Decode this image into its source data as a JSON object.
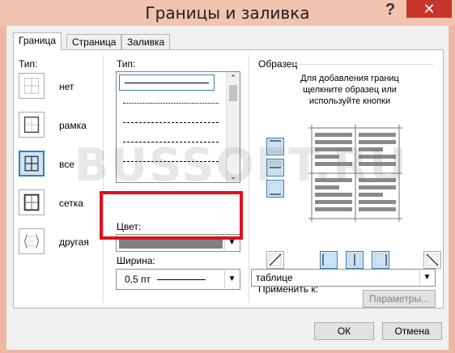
{
  "window": {
    "title": "Границы и заливка",
    "help": "?",
    "close": "✕"
  },
  "tabs": [
    {
      "label": "Граница",
      "active": true
    },
    {
      "label": "Страница",
      "active": false
    },
    {
      "label": "Заливка",
      "active": false
    }
  ],
  "presets": {
    "heading": "Тип:",
    "items": [
      {
        "label": "нет",
        "selected": false
      },
      {
        "label": "рамка",
        "selected": false
      },
      {
        "label": "все",
        "selected": true
      },
      {
        "label": "сетка",
        "selected": false
      },
      {
        "label": "другая",
        "selected": false
      }
    ]
  },
  "style": {
    "heading": "Тип:",
    "color_label": "Цвет:",
    "width_label": "Ширина:",
    "width_value": "0,5 пт"
  },
  "preview": {
    "heading": "Образец",
    "hint": [
      "Для добавления границ",
      "щелкните образец или",
      "используйте кнопки"
    ]
  },
  "apply_to": {
    "label": "Применить к:",
    "value": "таблице"
  },
  "buttons": {
    "params": "Параметры...",
    "ok": "ОК",
    "cancel": "Отмена"
  },
  "watermark": "BUSSOFT.RU",
  "colors": {
    "highlight": "#e0101e",
    "selected_border": "#3c7fb1",
    "titlebar": "#f2c3ae"
  }
}
